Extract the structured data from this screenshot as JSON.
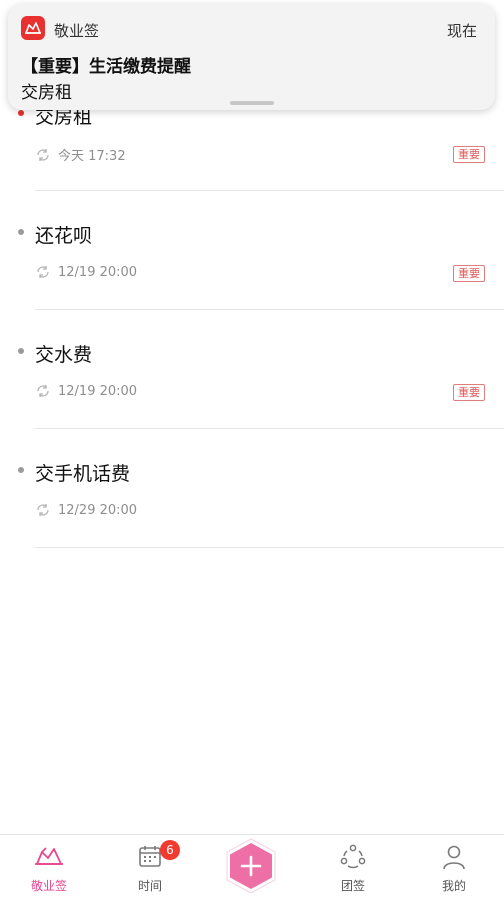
{
  "notification": {
    "app_name": "敬业签",
    "time": "现在",
    "title": "【重要】生活缴费提醒",
    "body": "交房租"
  },
  "items": [
    {
      "name": "交房租",
      "time": "今天 17:32",
      "tag": "重要",
      "dot": "red"
    },
    {
      "name": "还花呗",
      "time": "12/19 20:00",
      "tag": "重要",
      "dot": "gray"
    },
    {
      "name": "交水费",
      "time": "12/19 20:00",
      "tag": "重要",
      "dot": "gray"
    },
    {
      "name": "交手机话费",
      "time": "12/29 20:00",
      "tag": "",
      "dot": "gray"
    }
  ],
  "tabbar": {
    "tabs": [
      {
        "label": "敬业签",
        "icon": "notes-icon",
        "active": true
      },
      {
        "label": "时间",
        "icon": "calendar-icon",
        "badge": "6"
      },
      {
        "label": "团签",
        "icon": "team-icon"
      },
      {
        "label": "我的",
        "icon": "profile-icon"
      }
    ],
    "add_icon": "plus-icon"
  },
  "colors": {
    "accent": "#e8468f",
    "brand_red": "#e8312f",
    "tag_red": "#e05a5a",
    "badge_red": "#f23b30"
  }
}
